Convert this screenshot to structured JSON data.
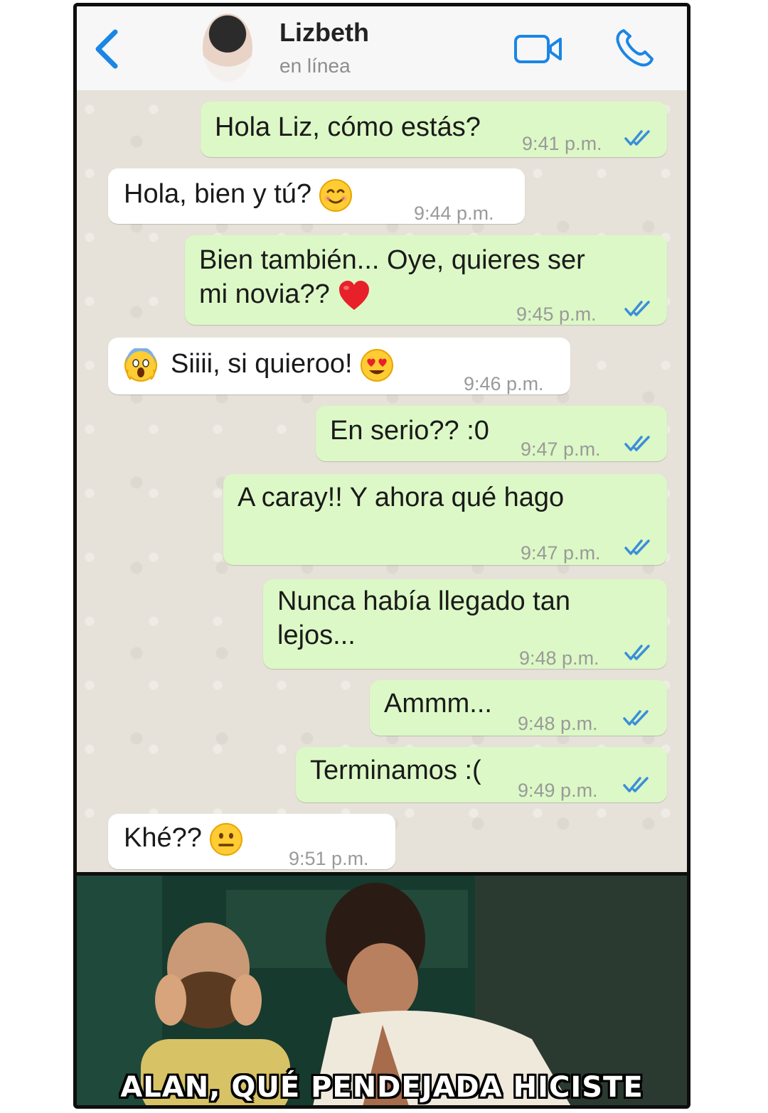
{
  "header": {
    "contact_name": "Lizbeth",
    "contact_status": "en línea",
    "icons": [
      "back-chevron-icon",
      "avatar",
      "video-call-icon",
      "phone-call-icon"
    ],
    "accent_color": "#1a86e5"
  },
  "messages": [
    {
      "side": "out",
      "lines": [
        "Hola Liz, cómo estás?"
      ],
      "time": "9:41 p.m.",
      "read": true
    },
    {
      "side": "in",
      "lines": [
        "Hola, bien y tú?"
      ],
      "emoji_after": "smiling-face-emoji",
      "time": "9:44 p.m."
    },
    {
      "side": "out",
      "lines": [
        "Bien también... Oye, quieres ser",
        "mi novia??"
      ],
      "emoji_after": "red-heart-emoji",
      "time": "9:45 p.m.",
      "read": true
    },
    {
      "side": "in",
      "lines": [
        "Siiii, si quieroo!"
      ],
      "emoji_before": "screaming-face-emoji",
      "emoji_after": "heart-eyes-emoji",
      "time": "9:46 p.m."
    },
    {
      "side": "out",
      "lines": [
        "En serio?? :0"
      ],
      "time": "9:47 p.m.",
      "read": true
    },
    {
      "side": "out",
      "lines": [
        "A caray!! Y ahora qué hago"
      ],
      "time": "9:47 p.m.",
      "read": true
    },
    {
      "side": "out",
      "lines": [
        "Nunca había llegado tan",
        "lejos..."
      ],
      "time": "9:48 p.m.",
      "read": true
    },
    {
      "side": "out",
      "lines": [
        "Ammm..."
      ],
      "time": "9:48 p.m.",
      "read": true
    },
    {
      "side": "out",
      "lines": [
        "Terminamos :("
      ],
      "time": "9:49 p.m.",
      "read": true
    },
    {
      "side": "in",
      "lines": [
        "Khé??"
      ],
      "emoji_after": "neutral-face-emoji",
      "time": "9:51 p.m."
    }
  ],
  "colors": {
    "outgoing_bubble": "#dcf8c6",
    "incoming_bubble": "#ffffff",
    "chat_background": "#e6e2d9",
    "read_ticks": "#3b8fd8"
  },
  "meme": {
    "caption": "ALAN, QUÉ PENDEJADA HICISTE"
  }
}
